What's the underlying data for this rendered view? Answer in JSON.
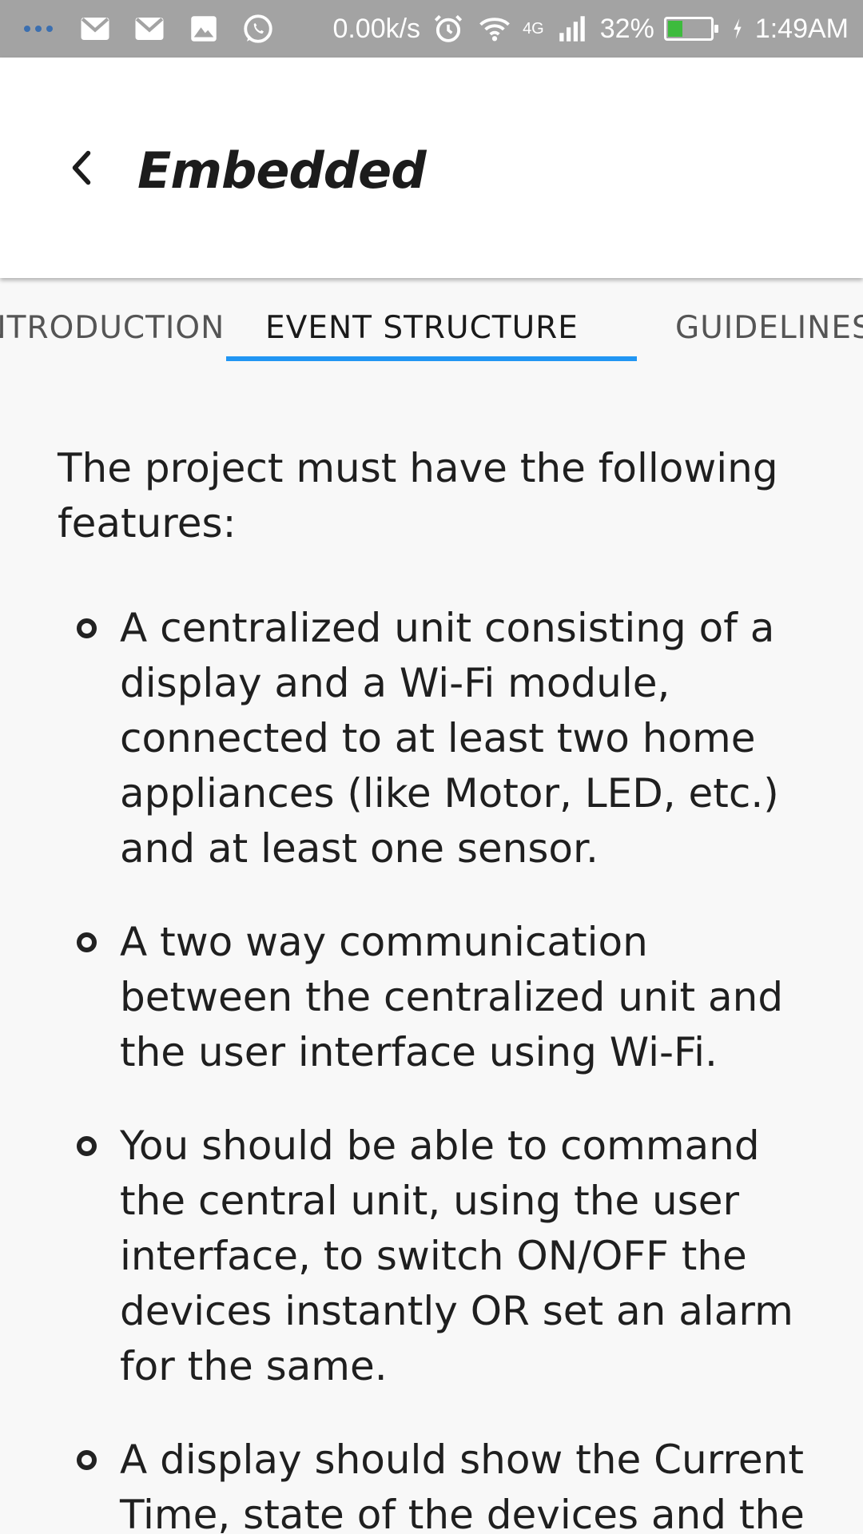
{
  "status_bar": {
    "network_speed": "0.00k/s",
    "network_type": "4G",
    "battery_percent": "32%",
    "battery_level": 0.32,
    "time": "1:49AM",
    "icons": [
      "more-dots-icon",
      "gmail-icon",
      "gmail-icon",
      "gallery-icon",
      "whatsapp-icon",
      "alarm-icon",
      "wifi-icon",
      "signal-icon",
      "battery-icon",
      "charging-icon"
    ]
  },
  "app_bar": {
    "title": "Embedded"
  },
  "tabs": [
    {
      "label": "INTRODUCTION",
      "active": false
    },
    {
      "label": "EVENT STRUCTURE",
      "active": true
    },
    {
      "label": "GUIDELINES",
      "active": false
    }
  ],
  "accent_color": "#2196f3",
  "content": {
    "intro": "The project must have the following features:",
    "features": [
      "A centralized unit consisting of a display and a Wi-Fi module, connected to at least two home appliances (like Motor, LED, etc.) and at least one sensor.",
      "A two way communication between the centralized unit and the user interface using Wi-Fi.",
      "You should be able to command the central unit, using the user interface, to switch ON/OFF the devices instantly OR set an alarm for the same.",
      "A display should show the Current Time, state of the devices and the"
    ]
  }
}
